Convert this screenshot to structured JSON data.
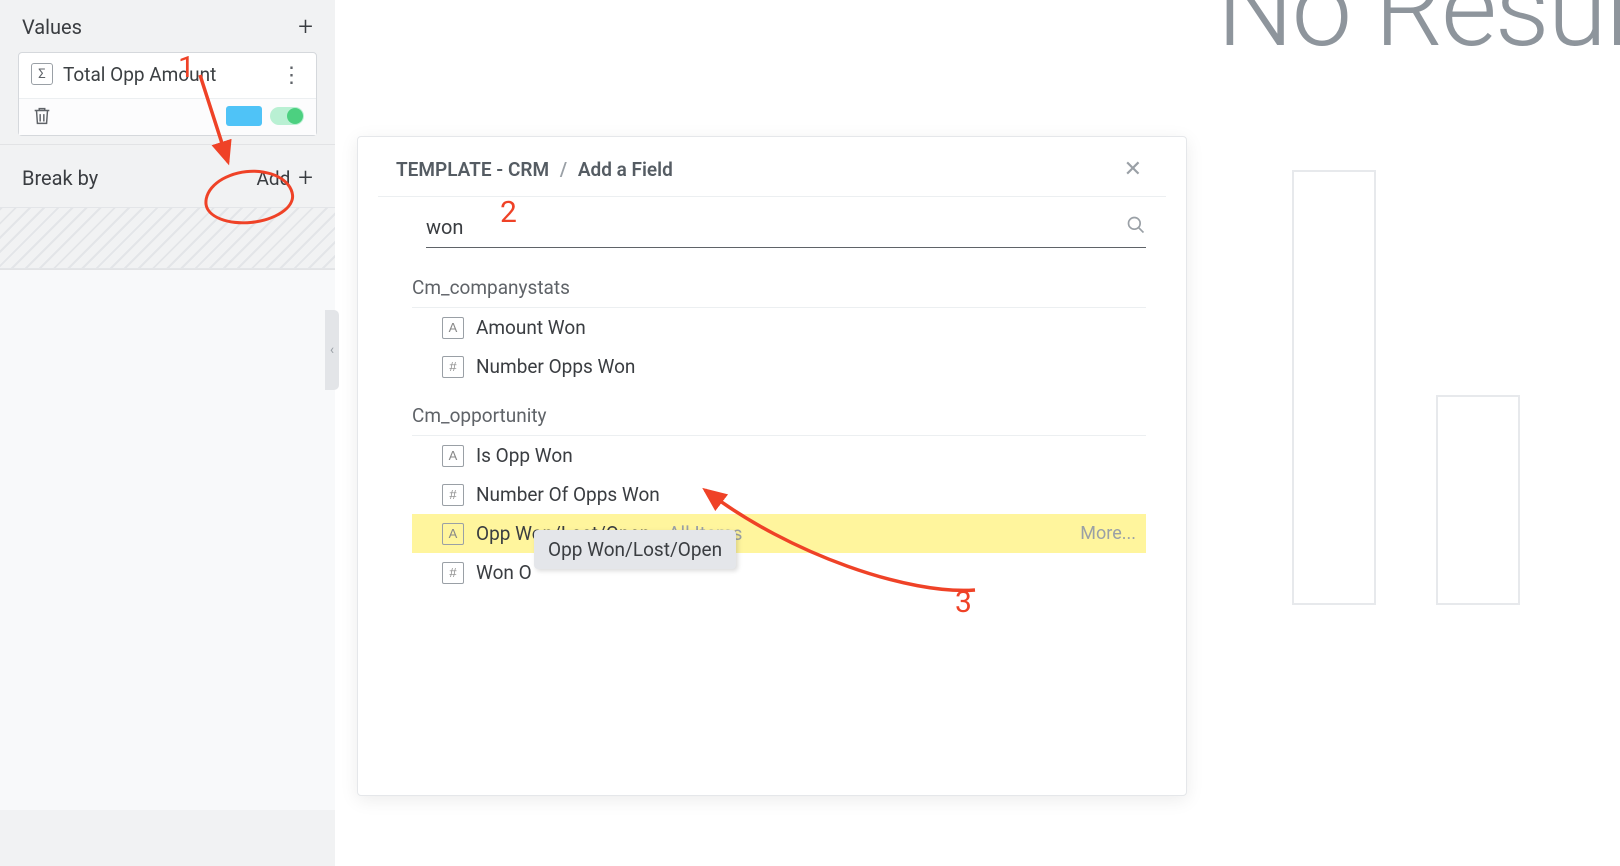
{
  "sidebar": {
    "values_title": "Values",
    "value_item": {
      "label": "Total Opp Amount",
      "sigma": "Σ"
    },
    "breakby_title": "Break by",
    "add_label": "Add"
  },
  "canvas": {
    "big_text": "No Result"
  },
  "modal": {
    "crumb_root": "TEMPLATE - CRM",
    "crumb_sep": "/",
    "crumb_tail": "Add a Field",
    "search_value": "won",
    "groups": [
      {
        "title": "Cm_companystats",
        "fields": [
          {
            "type": "A",
            "name": "Amount Won"
          },
          {
            "type": "#",
            "name": "Number Opps Won"
          }
        ]
      },
      {
        "title": "Cm_opportunity",
        "fields": [
          {
            "type": "A",
            "name": "Is Opp Won"
          },
          {
            "type": "#",
            "name": "Number Of Opps Won"
          },
          {
            "type": "A",
            "name": "Opp Won/Lost/Open",
            "highlight": true,
            "all_items": "All Items",
            "more": "More..."
          },
          {
            "type": "#",
            "name": "Won O"
          }
        ]
      }
    ]
  },
  "tooltip": {
    "text": "Opp Won/Lost/Open"
  },
  "annotations": {
    "n1": "1",
    "n2": "2",
    "n3": "3"
  }
}
